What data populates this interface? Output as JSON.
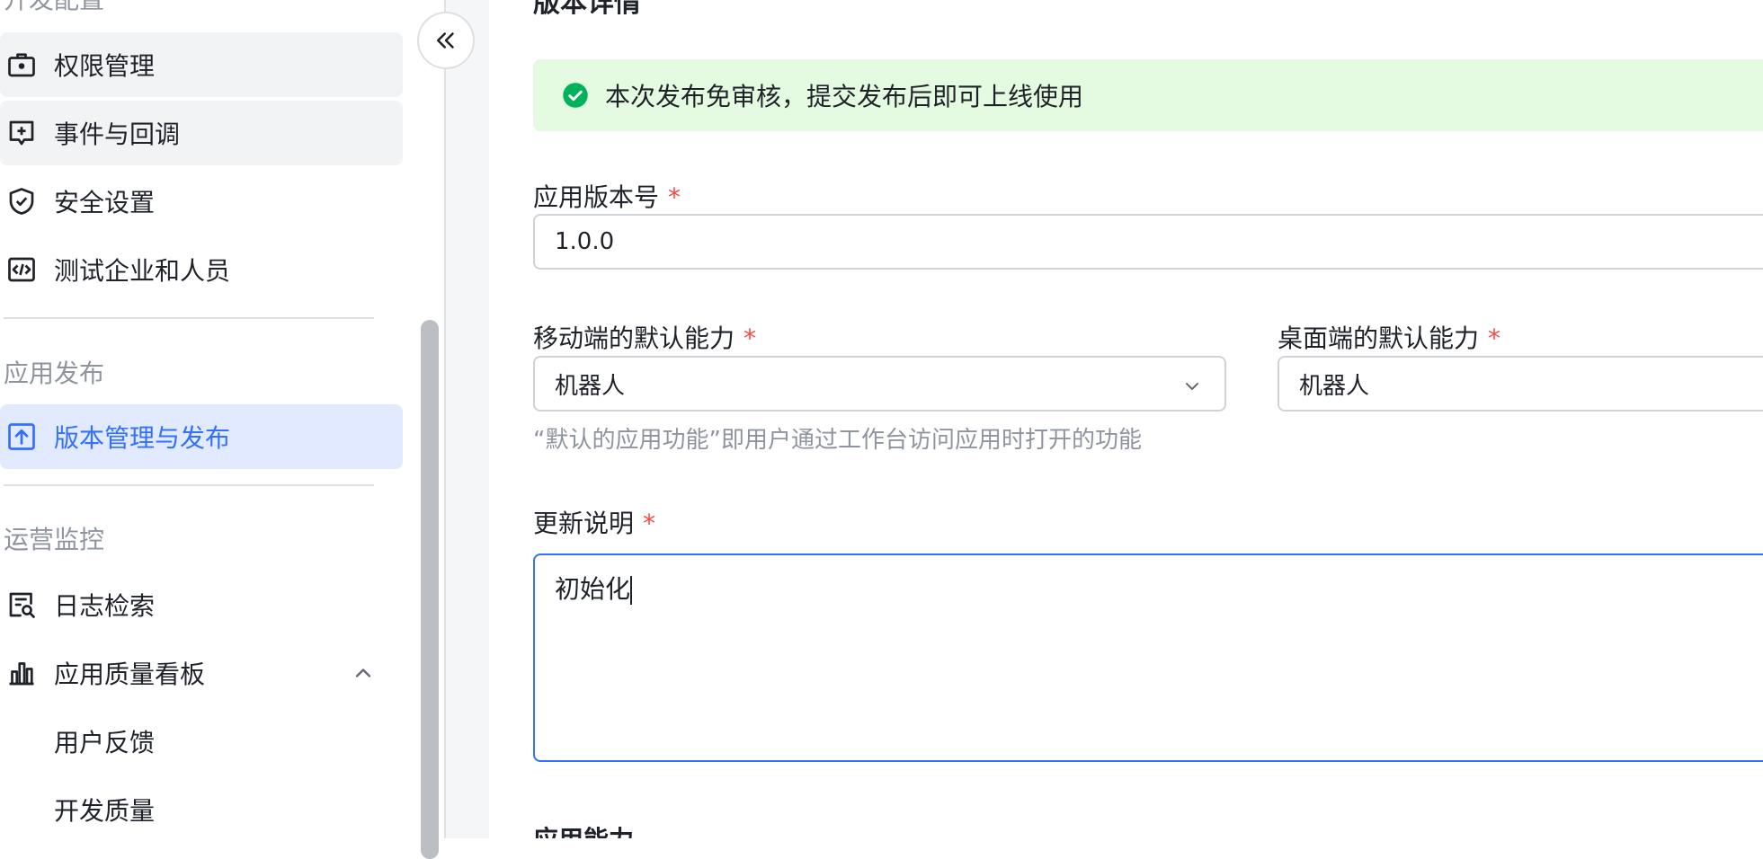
{
  "sidebar": {
    "sections": [
      {
        "title": "开发配置"
      },
      {
        "title": "应用发布"
      },
      {
        "title": "运营监控"
      }
    ],
    "items": [
      {
        "label": "权限管理",
        "icon": "briefcase-lock-icon"
      },
      {
        "label": "事件与回调",
        "icon": "event-add-icon"
      },
      {
        "label": "安全设置",
        "icon": "shield-check-icon"
      },
      {
        "label": "测试企业和人员",
        "icon": "code-test-icon"
      },
      {
        "label": "版本管理与发布",
        "icon": "upload-version-icon"
      },
      {
        "label": "日志检索",
        "icon": "log-search-icon"
      },
      {
        "label": "应用质量看板",
        "icon": "bar-chart-icon"
      },
      {
        "label": "用户反馈"
      },
      {
        "label": "开发质量"
      }
    ],
    "active_item": "版本管理与发布"
  },
  "main": {
    "title": "版本详情",
    "notice": "本次发布免审核，提交发布后即可上线使用",
    "version": {
      "label": "应用版本号",
      "required": "*",
      "value": "1.0.0"
    },
    "mobile_default": {
      "label": "移动端的默认能力",
      "required": "*",
      "value": "机器人"
    },
    "desktop_default": {
      "label": "桌面端的默认能力",
      "required": "*",
      "value": "机器人"
    },
    "default_hint": "“默认的应用功能”即用户通过工作台访问应用时打开的功能",
    "update_notes": {
      "label": "更新说明",
      "required": "*",
      "value": "初始化"
    },
    "next_section": "应用能力"
  },
  "colors": {
    "accent": "#3370ff",
    "active_bg": "#e1eaff",
    "success": "#00b259",
    "notice_bg": "#e4fae1",
    "required": "#f54a45"
  }
}
